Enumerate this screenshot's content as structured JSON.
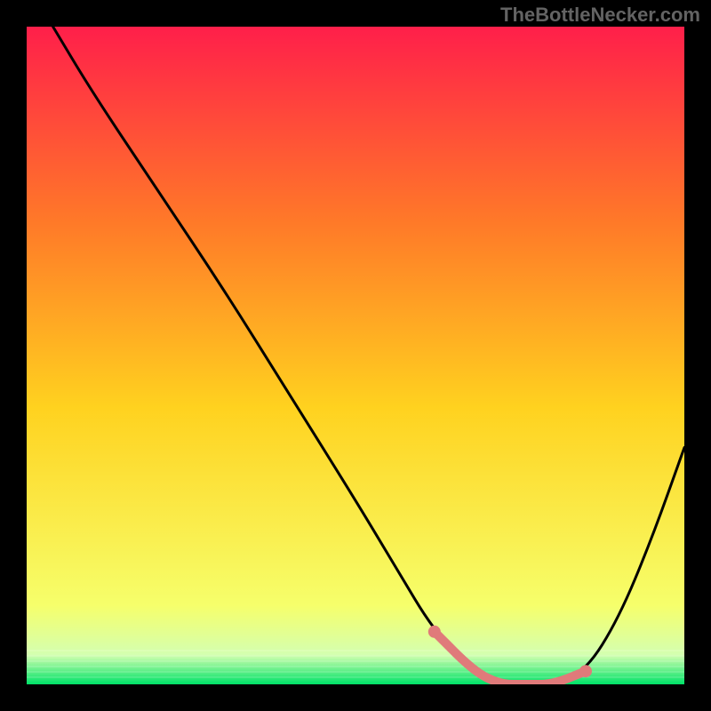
{
  "watermark": "TheBottleNecker.com",
  "chart_data": {
    "type": "line",
    "title": "",
    "xlabel": "",
    "ylabel": "",
    "xlim": [
      0,
      100
    ],
    "ylim": [
      0,
      100
    ],
    "background_gradient": {
      "top": "#ff1f4a",
      "upper_mid": "#ff7a28",
      "mid": "#ffd21f",
      "lower": "#f6ff6b",
      "bottom": "#00e268"
    },
    "series": [
      {
        "name": "bottleneck-curve",
        "color": "#000000",
        "x": [
          4,
          10,
          20,
          30,
          40,
          50,
          56,
          62,
          68,
          72,
          76,
          80,
          85,
          90,
          95,
          100
        ],
        "values": [
          100,
          90,
          75,
          60,
          44,
          28,
          18,
          8,
          2,
          0,
          0,
          0,
          2,
          10,
          22,
          36
        ]
      }
    ],
    "highlight_segment": {
      "name": "optimal-range",
      "color": "#e07a7a",
      "x": [
        56,
        62,
        68,
        72,
        76,
        80,
        85
      ],
      "values": [
        18,
        8,
        2,
        0,
        0,
        0,
        2
      ],
      "draw_from_index": 1
    }
  }
}
